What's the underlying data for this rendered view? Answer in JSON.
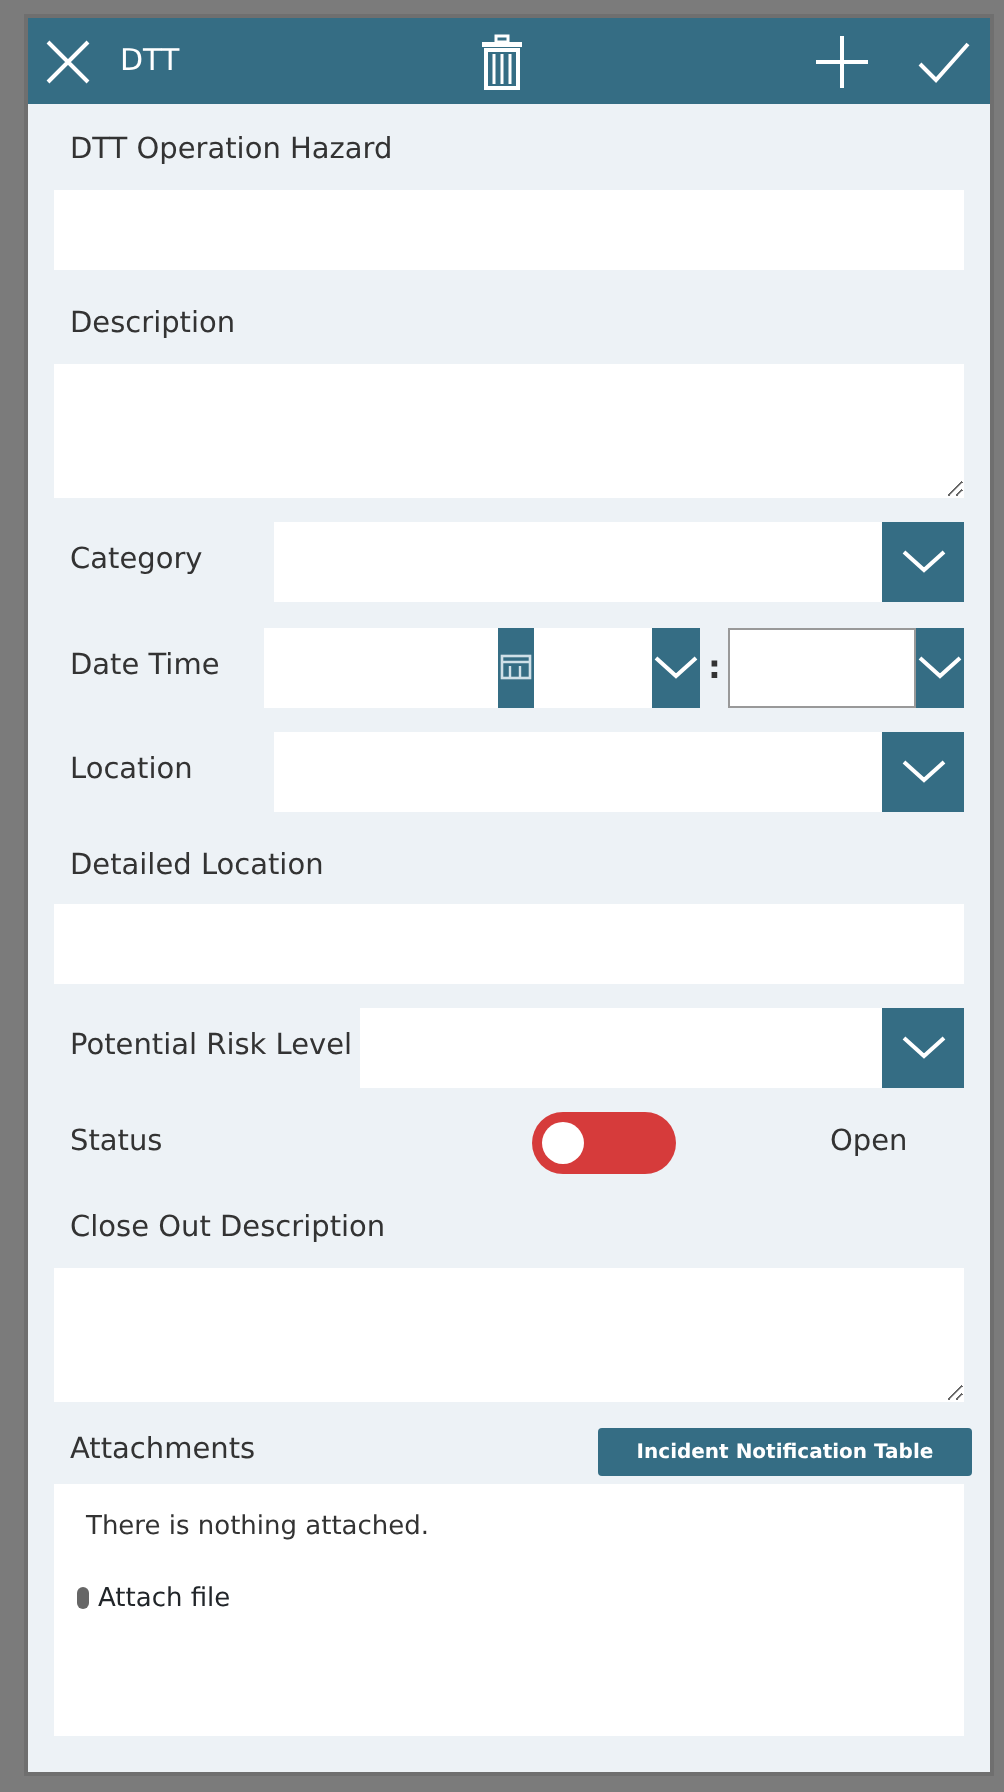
{
  "header": {
    "title": "DTT"
  },
  "fields": [
    {
      "kind": "text",
      "label": "DTT Operation Hazard"
    },
    {
      "kind": "textarea",
      "label": "Description"
    },
    {
      "kind": "dropdown",
      "label": "Category"
    },
    {
      "kind": "datetime",
      "label": "Date Time",
      "separator": ":"
    },
    {
      "kind": "dropdown",
      "label": "Location"
    },
    {
      "kind": "text",
      "label": "Detailed Location"
    },
    {
      "kind": "dropdown",
      "label": "Potential Risk Level"
    },
    {
      "kind": "toggle",
      "label": "Status",
      "on": false,
      "state_text": "Open"
    },
    {
      "kind": "textarea",
      "label": "Close Out Description"
    }
  ],
  "attachments": {
    "label": "Attachments",
    "button": "Incident Notification Table",
    "empty_text": "There is nothing attached.",
    "attach_link": "Attach file"
  }
}
